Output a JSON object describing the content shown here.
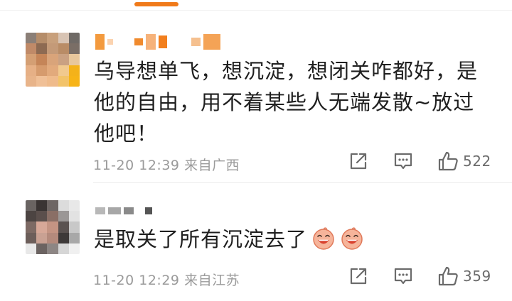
{
  "comments": [
    {
      "text": "乌导想单飞，想沉淀，想闭关咋都好，是他的自由，用不着某些人无端发散~放过他吧！",
      "time": "11-20 12:39",
      "location": "来自广西",
      "likes": "522"
    },
    {
      "text": "是取关了所有沉淀去了",
      "time": "11-20 12:29",
      "location": "来自江苏",
      "likes": "359"
    }
  ],
  "colors": {
    "accent": "#f07a1a",
    "text": "#1f1f1f",
    "meta": "#9a9a9a"
  },
  "icons": [
    "share-icon",
    "comment-icon",
    "like-icon",
    "laughing-emoji"
  ]
}
